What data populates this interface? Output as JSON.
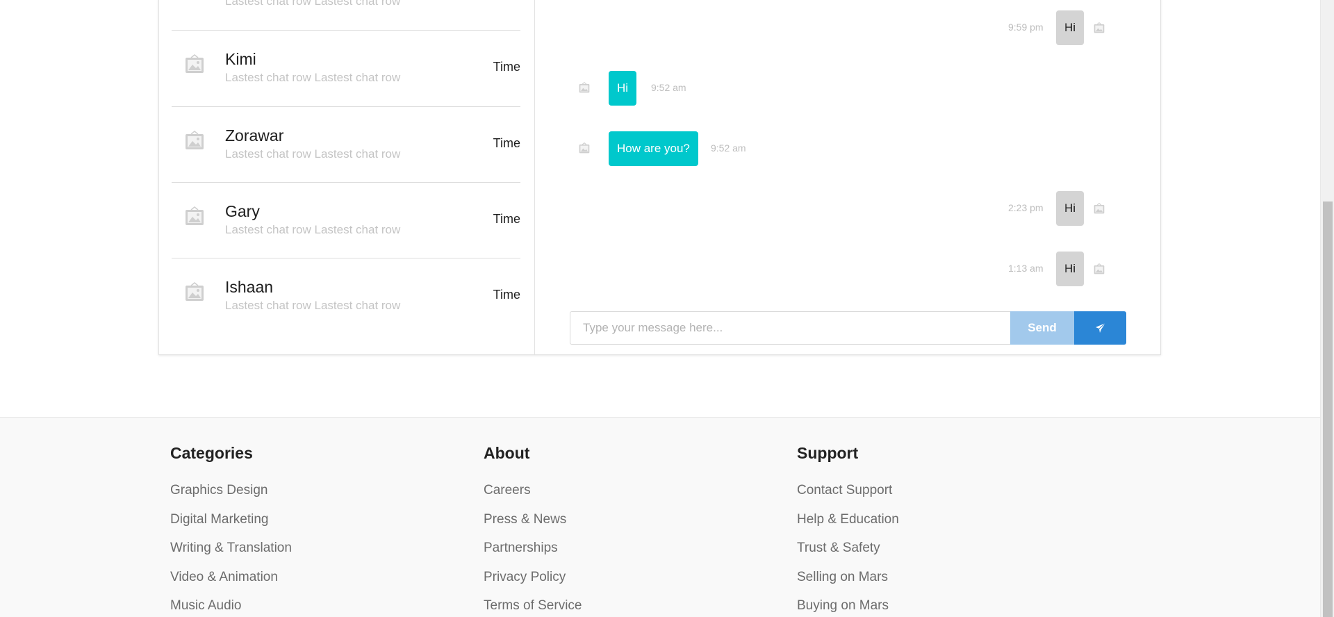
{
  "contacts": {
    "partial_preview": "Lastest chat row Lastest chat row",
    "items": [
      {
        "name": "Kimi",
        "preview": "Lastest chat row Lastest chat row",
        "time": "Time"
      },
      {
        "name": "Zorawar",
        "preview": "Lastest chat row Lastest chat row",
        "time": "Time"
      },
      {
        "name": "Gary",
        "preview": "Lastest chat row Lastest chat row",
        "time": "Time"
      },
      {
        "name": "Ishaan",
        "preview": "Lastest chat row Lastest chat row",
        "time": "Time"
      }
    ]
  },
  "messages": [
    {
      "text": "Hi",
      "time": "9:59 pm",
      "direction": "outgoing"
    },
    {
      "text": "Hi",
      "time": "9:52 am",
      "direction": "incoming"
    },
    {
      "text": "How are you?",
      "time": "9:52 am",
      "direction": "incoming"
    },
    {
      "text": "Hi",
      "time": "2:23 pm",
      "direction": "outgoing"
    },
    {
      "text": "Hi",
      "time": "1:13 am",
      "direction": "outgoing"
    }
  ],
  "composer": {
    "placeholder": "Type your message here...",
    "send_label": "Send",
    "icon": "paper-plane-icon"
  },
  "footer": {
    "columns": [
      {
        "heading": "Categories",
        "links": [
          "Graphics Design",
          "Digital Marketing",
          "Writing & Translation",
          "Video & Animation",
          "Music Audio"
        ]
      },
      {
        "heading": "About",
        "links": [
          "Careers",
          "Press & News",
          "Partnerships",
          "Privacy Policy",
          "Terms of Service"
        ]
      },
      {
        "heading": "Support",
        "links": [
          "Contact Support",
          "Help & Education",
          "Trust & Safety",
          "Selling on Mars",
          "Buying on Mars"
        ]
      }
    ]
  },
  "colors": {
    "incoming_bubble": "#00c8cc",
    "outgoing_bubble": "#d4d4d4",
    "send_button": "#a2c9ec",
    "plane_button": "#2b86d6",
    "footer_background": "#f9f9f9"
  }
}
